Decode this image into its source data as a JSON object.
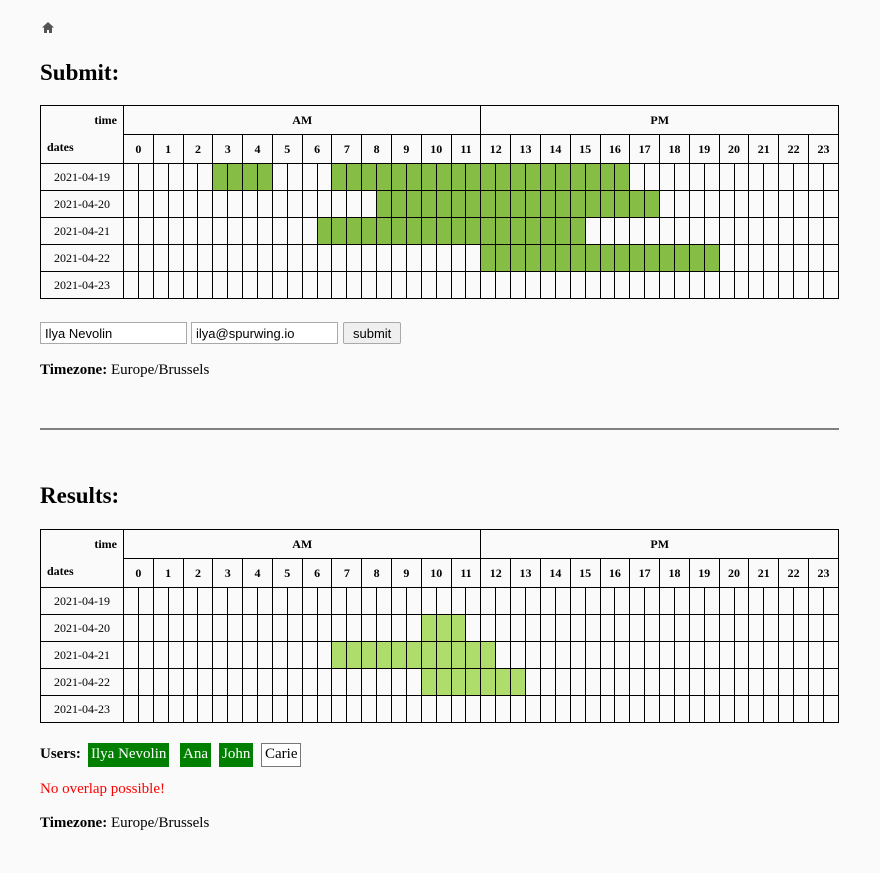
{
  "icons": {
    "home": "home-icon"
  },
  "submit": {
    "title": "Submit:",
    "name_value": "Ilya Nevolin",
    "email_value": "ilya@spurwing.io",
    "button_label": "submit",
    "timezone_label": "Timezone:",
    "timezone_value": "Europe/Brussels"
  },
  "results": {
    "title": "Results:",
    "users_label": "Users:",
    "users": [
      {
        "name": "Ilya Nevolin",
        "active": true
      },
      {
        "name": "Ana",
        "active": true
      },
      {
        "name": "John",
        "active": true
      },
      {
        "name": "Carie",
        "active": false
      }
    ],
    "warning": "No overlap possible!",
    "timezone_label": "Timezone:",
    "timezone_value": "Europe/Brussels"
  },
  "grid": {
    "time_label": "time",
    "dates_label": "dates",
    "am_label": "AM",
    "pm_label": "PM",
    "hours": [
      "0",
      "1",
      "2",
      "3",
      "4",
      "5",
      "6",
      "7",
      "8",
      "9",
      "10",
      "11",
      "12",
      "13",
      "14",
      "15",
      "16",
      "17",
      "18",
      "19",
      "20",
      "21",
      "22",
      "23"
    ],
    "dates": [
      "2021-04-19",
      "2021-04-20",
      "2021-04-21",
      "2021-04-22",
      "2021-04-23"
    ]
  },
  "submit_selection": [
    [
      6,
      7,
      8,
      9
    ],
    [
      14,
      15,
      16,
      17,
      18,
      19,
      20,
      21,
      22,
      23,
      24,
      25,
      26,
      27,
      28,
      29,
      30,
      31,
      32,
      33
    ],
    [
      17,
      18,
      19,
      20,
      21,
      22,
      23,
      24,
      25,
      26,
      27,
      28,
      29,
      30,
      31,
      32,
      33,
      34,
      35
    ],
    [
      13,
      14,
      15,
      16,
      17,
      18,
      19,
      20,
      21,
      22,
      23,
      24,
      25,
      26,
      27,
      28,
      29,
      30
    ],
    [
      24,
      25,
      26,
      27,
      28,
      29,
      30,
      31,
      32,
      33,
      34,
      35,
      36,
      37,
      38,
      39
    ],
    []
  ],
  "submit_rows": [
    [
      6,
      7,
      8,
      9,
      14,
      15,
      16,
      17,
      18,
      19,
      20,
      21,
      22,
      23,
      24,
      25,
      26,
      27,
      28,
      29,
      30,
      31,
      32,
      33
    ],
    [
      17,
      18,
      19,
      20,
      21,
      22,
      23,
      24,
      25,
      26,
      27,
      28,
      29,
      30,
      31,
      32,
      33,
      34,
      35
    ],
    [
      13,
      14,
      15,
      16,
      17,
      18,
      19,
      20,
      21,
      22,
      23,
      24,
      25,
      26,
      27,
      28,
      29,
      30
    ],
    [
      24,
      25,
      26,
      27,
      28,
      29,
      30,
      31,
      32,
      33,
      34,
      35,
      36,
      37,
      38,
      39
    ],
    []
  ],
  "result_rows": [
    [],
    [
      20,
      21,
      22
    ],
    [
      14,
      15,
      16,
      17,
      18,
      19,
      20,
      21,
      22,
      23,
      24
    ],
    [
      20,
      21,
      22,
      23,
      24,
      25,
      26
    ],
    []
  ],
  "colors": {
    "submit_fill": "#86bd45",
    "result_fill": "#aedd6b",
    "user_on": "#007f00",
    "warning": "#ff0000"
  }
}
